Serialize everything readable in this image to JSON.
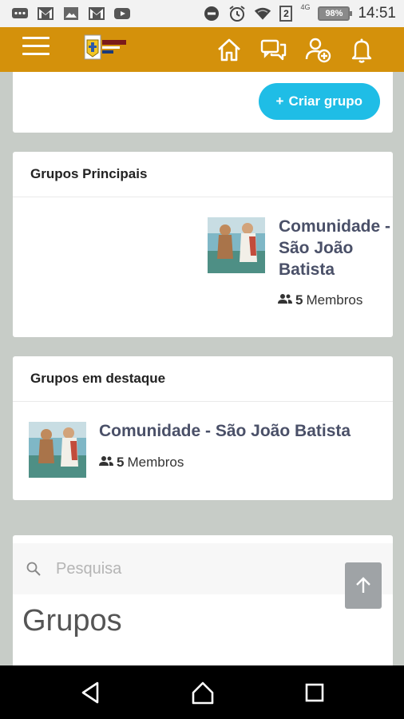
{
  "status_bar": {
    "time": "14:51",
    "battery": "98%",
    "sim_slot": "2",
    "network": "4G"
  },
  "header": {
    "logo_alt": "logo",
    "icons": [
      "menu-icon",
      "home-icon",
      "chat-icon",
      "add-user-icon",
      "bell-icon"
    ]
  },
  "actions": {
    "create_group_label": "Criar grupo"
  },
  "main_groups": {
    "title": "Grupos Principais",
    "items": [
      {
        "name": "Comunidade - São João Batista",
        "members_count": "5",
        "members_label": "Membros"
      }
    ]
  },
  "featured_groups": {
    "title": "Grupos em destaque",
    "items": [
      {
        "name": "Comunidade - São João Batista",
        "members_count": "5",
        "members_label": "Membros"
      }
    ]
  },
  "search": {
    "placeholder": "Pesquisa"
  },
  "groups_heading": "Grupos",
  "colors": {
    "header": "#d4910b",
    "accent": "#1fbde6",
    "background": "#c7ccc7",
    "group_name": "#4a5068"
  }
}
